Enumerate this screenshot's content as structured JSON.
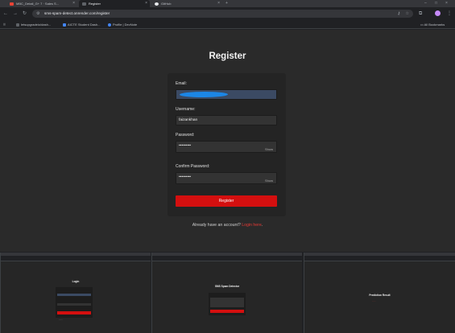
{
  "browser": {
    "tabs": [
      {
        "title": "MBC_Detail_G+ 7 · Sales S...",
        "active": false,
        "icon_color": "#ea4335"
      },
      {
        "title": "Register",
        "active": true,
        "icon_color": "#5f6368"
      },
      {
        "title": "GitHub",
        "active": false,
        "icon_color": "#e8eaed"
      }
    ],
    "new_tab_label": "+",
    "url": "sms-spam-detect.onrender.com/register",
    "bookmarks": [
      {
        "label": "letsupgradeio/dash...",
        "icon_color": "#5f6368"
      },
      {
        "label": "AICTE Student Dash...",
        "icon_color": "#4285f4"
      },
      {
        "label": "Profile | DevNote",
        "icon_color": "#4285f4"
      }
    ],
    "all_bookmarks_label": "All Bookmarks"
  },
  "form": {
    "title": "Register",
    "email_label": "Email:",
    "username_label": "Username:",
    "username_value": "faizankhan",
    "password_label": "Password:",
    "password_value": "•••••••••",
    "password_toggle": "Show",
    "confirm_label": "Confirm Password:",
    "confirm_value": "•••••••••",
    "confirm_toggle": "Show",
    "submit_label": "Register",
    "login_prompt": "Already have an account?",
    "login_link": "Login here"
  },
  "thumbnails": [
    {
      "title": "Login"
    },
    {
      "title": "SMS Spam Detector"
    },
    {
      "title": "Prediction Result"
    }
  ],
  "colors": {
    "accent": "#d40f0f",
    "link": "#e53935",
    "background": "#2a2a2a"
  }
}
